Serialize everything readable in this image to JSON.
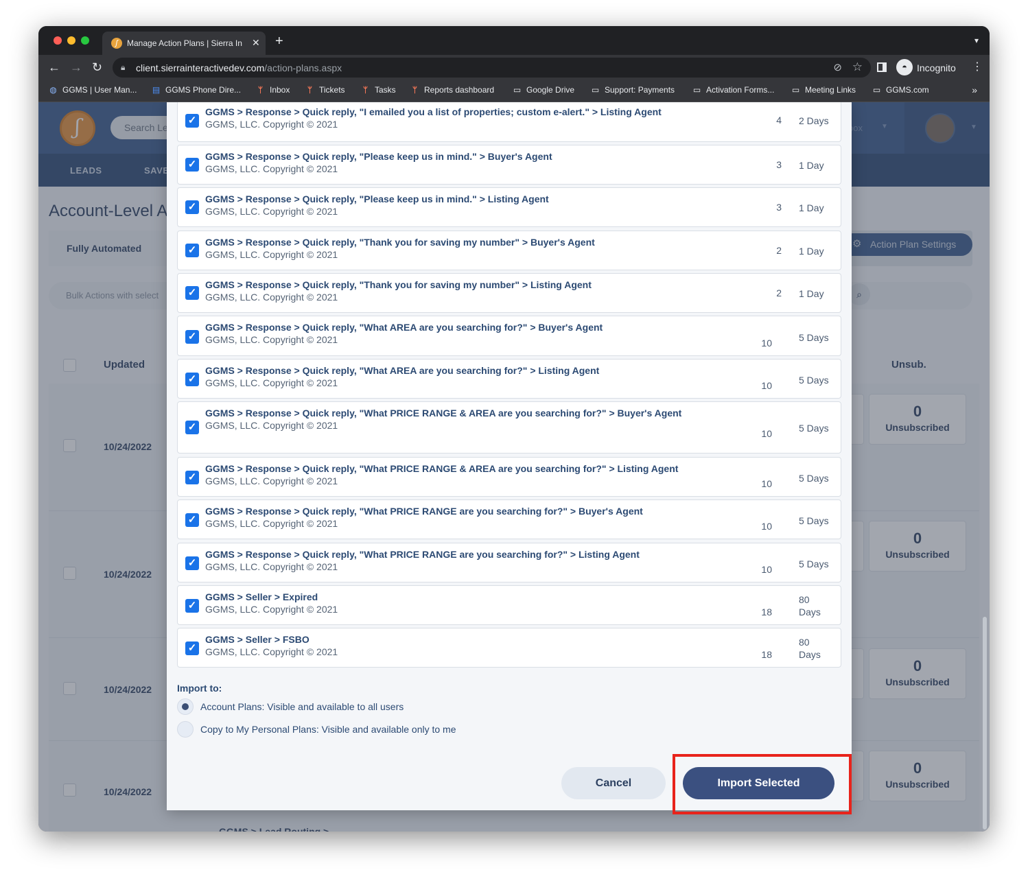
{
  "browser": {
    "tab_title": "Manage Action Plans | Sierra In",
    "tab_close": "✕",
    "new_tab": "+",
    "url_host": "client.sierrainteractivedev.com",
    "url_path": "/action-plans.aspx",
    "profile_label": "Incognito",
    "bookmarks": [
      {
        "label": "GGMS | User Man...",
        "icon": "globe-icon"
      },
      {
        "label": "GGMS Phone Dire...",
        "icon": "doc-icon"
      },
      {
        "label": "Inbox",
        "icon": "hubspot-icon"
      },
      {
        "label": "Tickets",
        "icon": "hubspot-icon"
      },
      {
        "label": "Tasks",
        "icon": "hubspot-icon"
      },
      {
        "label": "Reports dashboard",
        "icon": "hubspot-icon"
      },
      {
        "label": "Google Drive",
        "icon": "folder-icon"
      },
      {
        "label": "Support: Payments",
        "icon": "folder-icon"
      },
      {
        "label": "Activation Forms...",
        "icon": "folder-icon"
      },
      {
        "label": "Meeting Links",
        "icon": "folder-icon"
      },
      {
        "label": "GGMS.com",
        "icon": "folder-icon"
      }
    ],
    "bookmarks_more": "»"
  },
  "app": {
    "search_placeholder": "Search Le",
    "inbox_label": "box",
    "nav": [
      "LEADS",
      "SAVE"
    ],
    "page_title": "Account-Level A",
    "subtab_active": "Fully Automated",
    "settings_button": "Action Plan Settings",
    "bulk_actions": "Bulk Actions with select",
    "col_updated": "Updated",
    "col_unsub": "Unsub.",
    "rows": [
      {
        "date": "10/24/2022",
        "unsub_count": "0",
        "unsub_label": "Unsubscribed"
      },
      {
        "date": "10/24/2022",
        "unsub_count": "0",
        "unsub_label": "Unsubscribed"
      },
      {
        "date": "10/24/2022",
        "unsub_count": "0",
        "unsub_label": "Unsubscribed"
      },
      {
        "date": "10/24/2022",
        "unsub_count": "0",
        "unsub_label": "Unsubscribed"
      }
    ],
    "bottom_row_partial": "GGMS > Lead Routing >"
  },
  "modal": {
    "items": [
      {
        "name": "GGMS > Response > Quick reply, \"I emailed you a list of properties; custom e-alert.\" > Listing Agent",
        "copyright": "GGMS, LLC. Copyright © 2021",
        "steps": "4",
        "days": "2 Days",
        "checked": true
      },
      {
        "name": "GGMS > Response > Quick reply, \"Please keep us in mind.\" > Buyer's Agent",
        "copyright": "GGMS, LLC. Copyright © 2021",
        "steps": "3",
        "days": "1 Day",
        "checked": true
      },
      {
        "name": "GGMS > Response > Quick reply, \"Please keep us in mind.\" > Listing Agent",
        "copyright": "GGMS, LLC. Copyright © 2021",
        "steps": "3",
        "days": "1 Day",
        "checked": true
      },
      {
        "name": "GGMS > Response > Quick reply, \"Thank you for saving my number\" > Buyer's Agent",
        "copyright": "GGMS, LLC. Copyright © 2021",
        "steps": "2",
        "days": "1 Day",
        "checked": true
      },
      {
        "name": "GGMS > Response > Quick reply, \"Thank you for saving my number\" > Listing Agent",
        "copyright": "GGMS, LLC. Copyright © 2021",
        "steps": "2",
        "days": "1 Day",
        "checked": true
      },
      {
        "name": "GGMS > Response > Quick reply, \"What AREA are you searching for?\" > Buyer's Agent",
        "copyright": "GGMS, LLC. Copyright © 2021",
        "steps": "10",
        "days": "5 Days",
        "checked": true
      },
      {
        "name": "GGMS > Response > Quick reply, \"What AREA are you searching for?\" > Listing Agent",
        "copyright": "GGMS, LLC. Copyright © 2021",
        "steps": "10",
        "days": "5 Days",
        "checked": true
      },
      {
        "name": "GGMS > Response > Quick reply, \"What PRICE RANGE & AREA are you searching for?\" > Buyer's Agent",
        "copyright": "GGMS, LLC. Copyright © 2021",
        "steps": "10",
        "days": "5 Days",
        "checked": true
      },
      {
        "name": "GGMS > Response > Quick reply, \"What PRICE RANGE & AREA are you searching for?\" > Listing Agent",
        "copyright": "GGMS, LLC. Copyright © 2021",
        "steps": "10",
        "days": "5 Days",
        "checked": true
      },
      {
        "name": "GGMS > Response > Quick reply, \"What PRICE RANGE are you searching for?\" > Buyer's Agent",
        "copyright": "GGMS, LLC. Copyright © 2021",
        "steps": "10",
        "days": "5 Days",
        "checked": true
      },
      {
        "name": "GGMS > Response > Quick reply, \"What PRICE RANGE are you searching for?\" > Listing Agent",
        "copyright": "GGMS, LLC. Copyright © 2021",
        "steps": "10",
        "days": "5 Days",
        "checked": true
      },
      {
        "name": "GGMS > Seller > Expired",
        "copyright": "GGMS, LLC. Copyright © 2021",
        "steps": "18",
        "days": "80 Days",
        "checked": true
      },
      {
        "name": "GGMS > Seller > FSBO",
        "copyright": "GGMS, LLC. Copyright © 2021",
        "steps": "18",
        "days": "80 Days",
        "checked": true
      }
    ],
    "import_to_label": "Import to:",
    "options": [
      {
        "label": "Account Plans: Visible and available to all users",
        "selected": true
      },
      {
        "label": "Copy to My Personal Plans: Visible and available only to me",
        "selected": false
      }
    ],
    "cancel_label": "Cancel",
    "import_label": "Import Selected"
  },
  "colors": {
    "accent": "#3b5080",
    "checkbox": "#1a73e8",
    "highlight": "#e8231b",
    "header": "#3b5b8c"
  }
}
